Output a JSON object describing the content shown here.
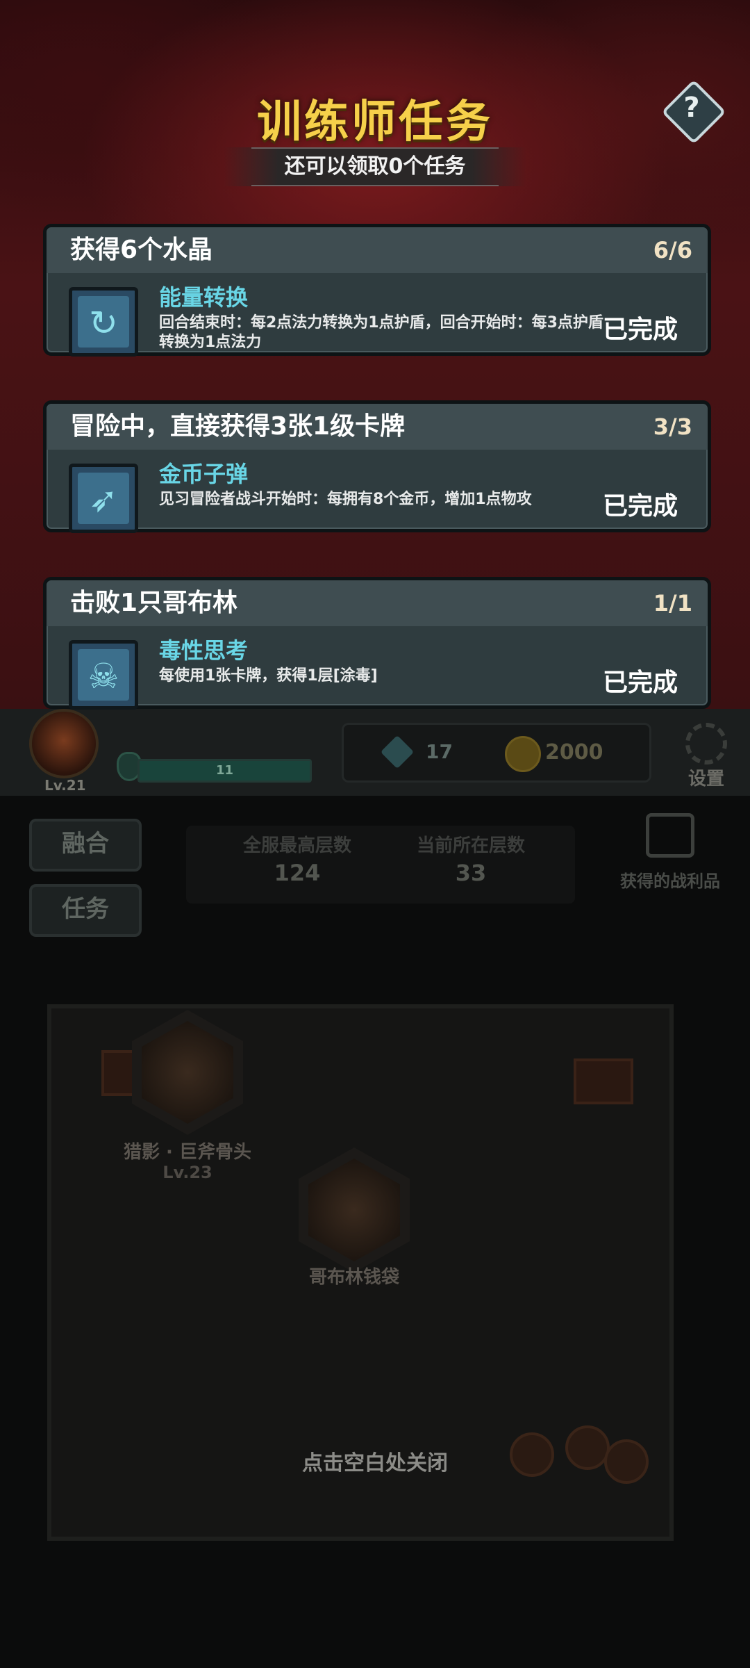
{
  "modal": {
    "title": "训练师任务",
    "subtitle": "还可以领取0个任务",
    "help_label": "?"
  },
  "quests": [
    {
      "title": "获得6个水晶",
      "progress": "6/6",
      "skill_name": "能量转换",
      "description": "回合结束时：每2点法力转换为1点护盾，回合开始时：每3点护盾转换为1点法力",
      "status": "已完成",
      "icon": "energy-swirl-icon"
    },
    {
      "title": "冒险中，直接获得3张1级卡牌",
      "progress": "3/3",
      "skill_name": "金币子弹",
      "description": "见习冒险者战斗开始时：每拥有8个金币，增加1点物攻",
      "status": "已完成",
      "icon": "coin-bullet-icon"
    },
    {
      "title": "击败1只哥布林",
      "progress": "1/1",
      "skill_name": "毒性思考",
      "description": "每使用1张卡牌，获得1层[涂毒]",
      "status": "已完成",
      "icon": "poison-skull-icon"
    }
  ],
  "hud": {
    "player_level": "Lv.21",
    "hp_value": "11",
    "hp_fill": 1.0,
    "gem_count": "17",
    "coin_count": "2000",
    "settings_label": "设置"
  },
  "side_buttons": {
    "fuse_label": "融合",
    "task_label": "任务"
  },
  "floors": {
    "best_label": "全服最高层数",
    "best_value": "124",
    "current_label": "当前所在层数",
    "current_value": "33"
  },
  "loot": {
    "label": "获得的战利品"
  },
  "map": {
    "boss_name": "猎影 · 巨斧骨头",
    "boss_level": "Lv.23",
    "bag_name": "哥布林钱袋"
  },
  "close_hint": "点击空白处关闭",
  "colors": {
    "title_gold": "#f6d04a",
    "skill_cyan": "#69d6e6",
    "card_bg": "#2f3c3f",
    "progress_cream": "#f1e2c4"
  }
}
